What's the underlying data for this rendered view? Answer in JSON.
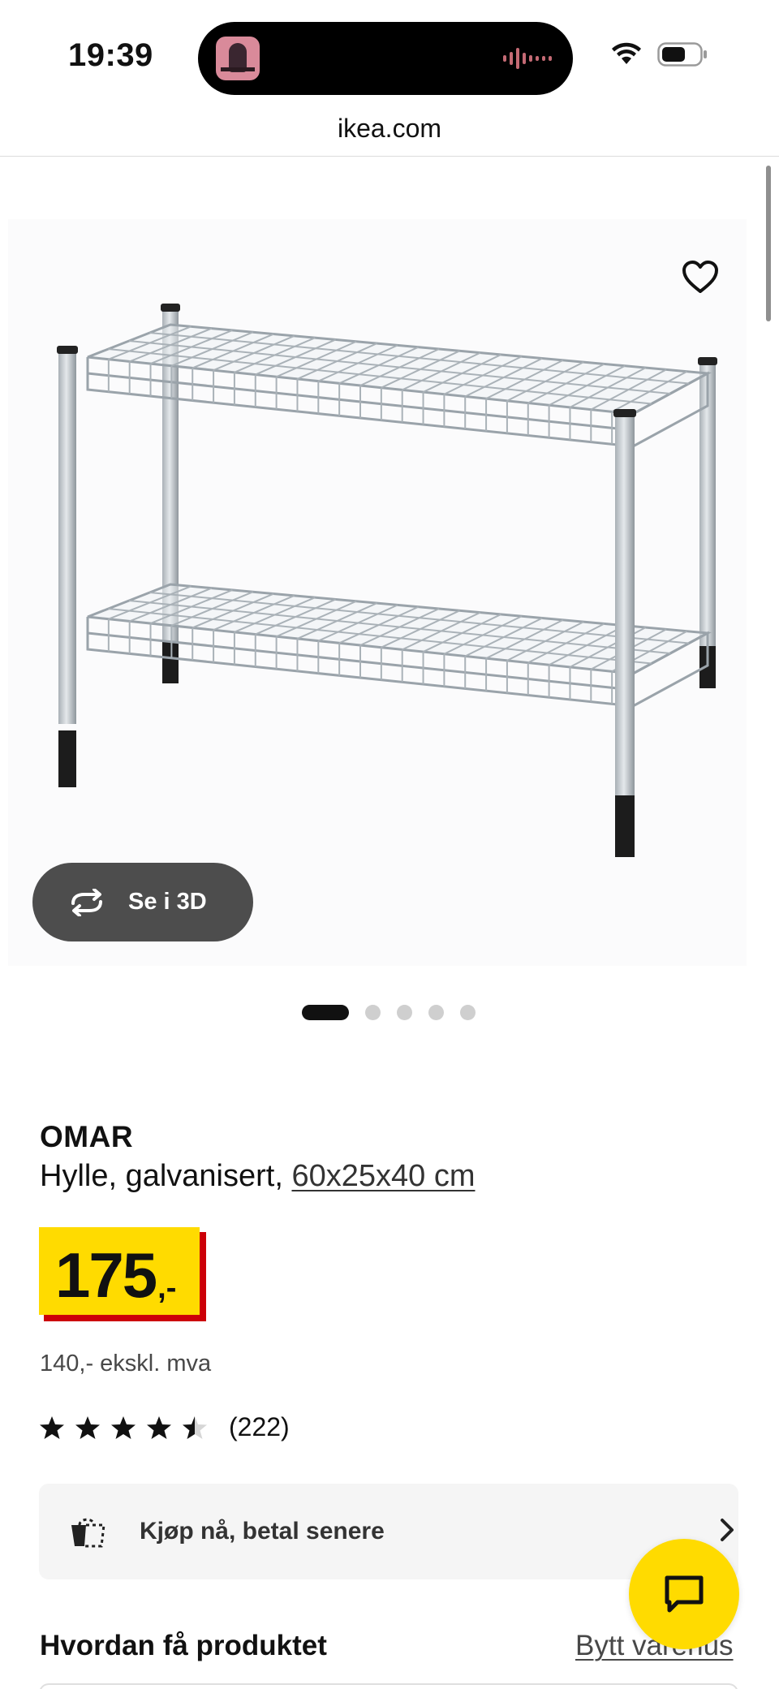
{
  "status_bar": {
    "time": "19:39",
    "icons": [
      "wifi-icon",
      "battery-icon"
    ],
    "island_waveform": "audio-waveform-icon"
  },
  "browser": {
    "url": "ikea.com"
  },
  "gallery": {
    "favorite_icon": "heart-outline-icon",
    "view_3d_label": "Se i 3D",
    "view_3d_icon": "rotate-arrows-icon",
    "image_count": 5,
    "active_image_index": 0
  },
  "product": {
    "name": "OMAR",
    "description": "Hylle, galvanisert,",
    "size": "60x25x40 cm",
    "price_main": "175",
    "price_suffix": ",-",
    "price_ex_vat": "140,- ekskl. mva",
    "rating": 4.5,
    "rating_max": 5,
    "review_count": "(222)"
  },
  "klarna": {
    "label": "Kjøp nå, betal senere",
    "icon": "bag-icon"
  },
  "chat": {
    "icon": "chat-bubble-icon"
  },
  "delivery": {
    "title": "Hvordan få produktet",
    "change_store": "Bytt varehus"
  },
  "colors": {
    "price_yellow": "#ffdb00",
    "price_red": "#cc0008",
    "button_dark": "#4d4d4d",
    "chat_yellow": "#ffdb00"
  }
}
